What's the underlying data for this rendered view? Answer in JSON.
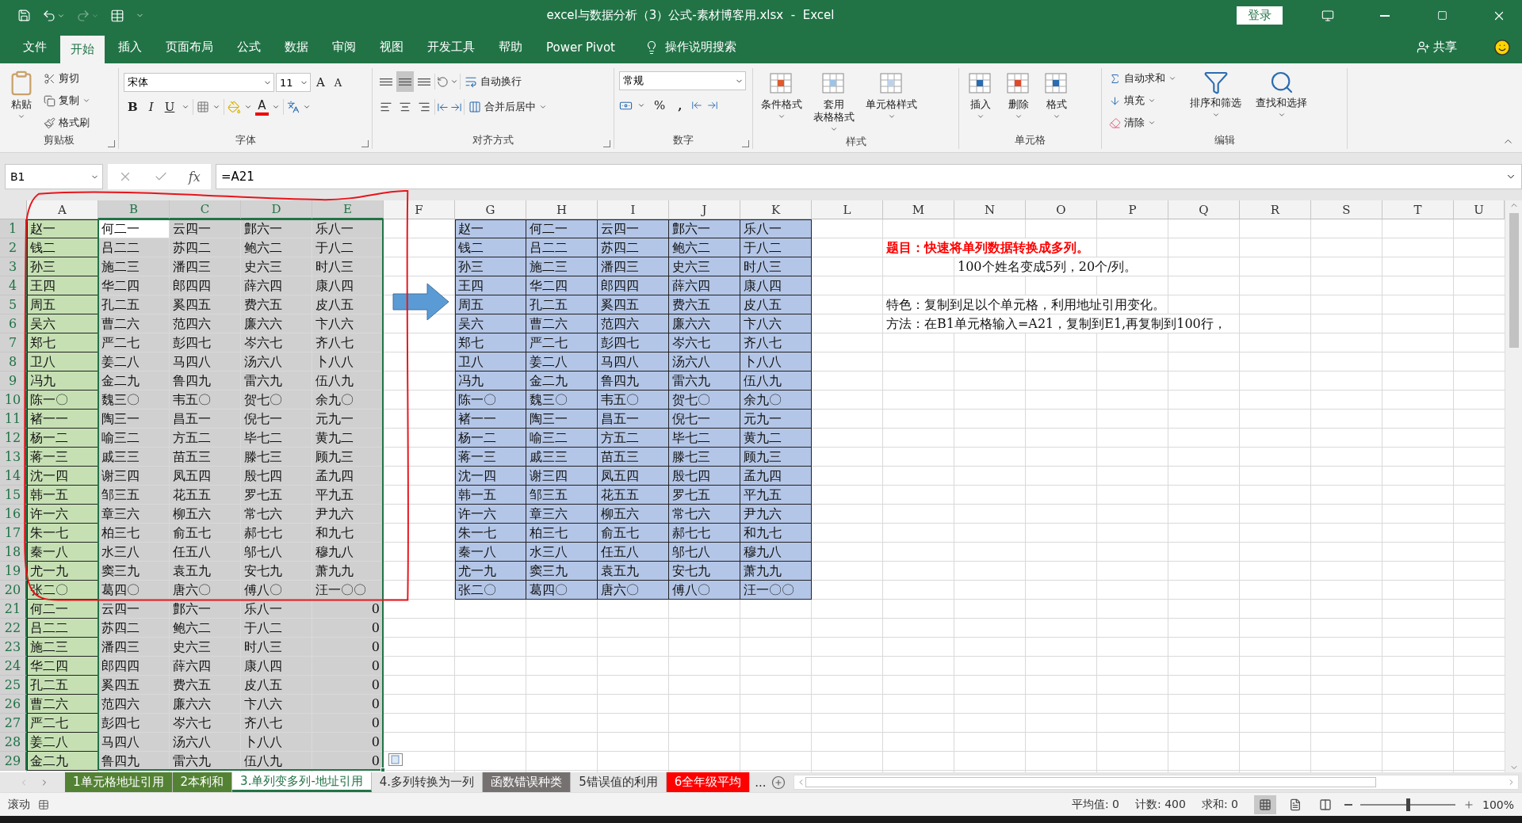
{
  "title_bar": {
    "title": "excel与数据分析（3）公式-素材博客用.xlsx  -  Excel",
    "login": "登录"
  },
  "menu": {
    "tabs": [
      {
        "label": "文件",
        "selected": false
      },
      {
        "label": "开始",
        "selected": true
      },
      {
        "label": "插入",
        "selected": false
      },
      {
        "label": "页面布局",
        "selected": false
      },
      {
        "label": "公式",
        "selected": false
      },
      {
        "label": "数据",
        "selected": false
      },
      {
        "label": "审阅",
        "selected": false
      },
      {
        "label": "视图",
        "selected": false
      },
      {
        "label": "开发工具",
        "selected": false
      },
      {
        "label": "帮助",
        "selected": false
      },
      {
        "label": "Power Pivot",
        "selected": false
      }
    ],
    "tell_me": "操作说明搜索",
    "share": "共享"
  },
  "ribbon": {
    "groups": [
      {
        "kind": "clipboard",
        "title": "剪贴板",
        "launcher": true,
        "paste": "粘贴",
        "items": [
          "剪切",
          "复制",
          "格式刷"
        ]
      },
      {
        "kind": "font",
        "title": "字体",
        "launcher": true,
        "font": "宋体",
        "size": "11",
        "grow": "A",
        "shrink": "A",
        "bold": "B",
        "italic": "I",
        "underline": "U",
        "font_color": "A"
      },
      {
        "kind": "alignment",
        "title": "对齐方式",
        "launcher": true,
        "valign": [
          {
            "selected": false
          },
          {
            "selected": true
          },
          {
            "selected": false
          }
        ],
        "halign": [
          {
            "selected": false
          },
          {
            "selected": false
          },
          {
            "selected": false
          }
        ],
        "wrap": "自动换行",
        "merge": "合并后居中"
      },
      {
        "kind": "number",
        "title": "数字",
        "launcher": true,
        "format": "常规",
        "percent": "%",
        "comma": ","
      },
      {
        "kind": "styles",
        "title": "样式",
        "buttons": [
          [
            "条件格式"
          ],
          [
            "套用",
            "表格格式"
          ],
          [
            "单元格样式"
          ]
        ]
      },
      {
        "kind": "cells",
        "title": "单元格",
        "buttons": [
          [
            "插入"
          ],
          [
            "删除"
          ],
          [
            "格式"
          ]
        ]
      },
      {
        "kind": "editing",
        "title": "编辑",
        "items": [
          "自动求和",
          "填充",
          "清除"
        ],
        "buttons": [
          [
            "排序和筛选"
          ],
          [
            "查找和选择"
          ]
        ]
      }
    ]
  },
  "formula_bar": {
    "name_box": "B1",
    "fx": "fx",
    "formula": "=A21"
  },
  "sheet": {
    "columns": [
      {
        "label": "A",
        "selected": false,
        "color": "#c6e0b4"
      },
      {
        "label": "B",
        "selected": true
      },
      {
        "label": "C",
        "selected": true
      },
      {
        "label": "D",
        "selected": true
      },
      {
        "label": "E",
        "selected": true
      },
      {
        "label": "F",
        "selected": false
      },
      {
        "label": "G",
        "selected": false,
        "color": "#b4c6e7"
      },
      {
        "label": "H",
        "selected": false,
        "color": "#b4c6e7"
      },
      {
        "label": "I",
        "selected": false,
        "color": "#b4c6e7"
      },
      {
        "label": "J",
        "selected": false,
        "color": "#b4c6e7"
      },
      {
        "label": "K",
        "selected": false,
        "color": "#b4c6e7"
      },
      {
        "label": "L",
        "selected": false
      },
      {
        "label": "M",
        "selected": false
      },
      {
        "label": "N",
        "selected": false
      },
      {
        "label": "O",
        "selected": false
      },
      {
        "label": "P",
        "selected": false
      },
      {
        "label": "Q",
        "selected": false
      },
      {
        "label": "R",
        "selected": false
      },
      {
        "label": "S",
        "selected": false
      },
      {
        "label": "T",
        "selected": false
      },
      {
        "label": "U",
        "selected": false
      }
    ],
    "rows": [
      {
        "number": "1",
        "selected": true,
        "cells": {
          "A": "赵一",
          "B": "何二一",
          "C": "云四一",
          "D": "鄷六一",
          "E": "乐八一",
          "G": "赵一",
          "H": "何二一",
          "I": "云四一",
          "J": "鄷六一",
          "K": "乐八一"
        }
      },
      {
        "number": "2",
        "selected": true,
        "cells": {
          "A": "钱二",
          "B": "吕二二",
          "C": "苏四二",
          "D": "鲍六二",
          "E": "于八二",
          "G": "钱二",
          "H": "吕二二",
          "I": "苏四二",
          "J": "鲍六二",
          "K": "于八二",
          "M": {
            "text": "题目：快速将单列数据转换成多列。",
            "kind": "heading"
          }
        }
      },
      {
        "number": "3",
        "selected": true,
        "cells": {
          "A": "孙三",
          "B": "施二三",
          "C": "潘四三",
          "D": "史六三",
          "E": "时八三",
          "G": "孙三",
          "H": "施二三",
          "I": "潘四三",
          "J": "史六三",
          "K": "时八三",
          "N": "100个姓名变成5列，20个/列。"
        }
      },
      {
        "number": "4",
        "selected": true,
        "cells": {
          "A": "王四",
          "B": "华二四",
          "C": "郎四四",
          "D": "薛六四",
          "E": "康八四",
          "G": "王四",
          "H": "华二四",
          "I": "郎四四",
          "J": "薛六四",
          "K": "康八四"
        }
      },
      {
        "number": "5",
        "selected": true,
        "cells": {
          "A": "周五",
          "B": "孔二五",
          "C": "奚四五",
          "D": "费六五",
          "E": "皮八五",
          "G": "周五",
          "H": "孔二五",
          "I": "奚四五",
          "J": "费六五",
          "K": "皮八五",
          "M": "特色：复制到足以个单元格，利用地址引用变化。"
        }
      },
      {
        "number": "6",
        "selected": true,
        "cells": {
          "A": "吴六",
          "B": "曹二六",
          "C": "范四六",
          "D": "廉六六",
          "E": "卞八六",
          "G": "吴六",
          "H": "曹二六",
          "I": "范四六",
          "J": "廉六六",
          "K": "卞八六",
          "M": "方法：在B1单元格输入=A21，复制到E1,再复制到100行，"
        }
      },
      {
        "number": "7",
        "selected": true,
        "cells": {
          "A": "郑七",
          "B": "严二七",
          "C": "彭四七",
          "D": "岑六七",
          "E": "齐八七",
          "G": "郑七",
          "H": "严二七",
          "I": "彭四七",
          "J": "岑六七",
          "K": "齐八七"
        }
      },
      {
        "number": "8",
        "selected": true,
        "cells": {
          "A": "卫八",
          "B": "姜二八",
          "C": "马四八",
          "D": "汤六八",
          "E": "卜八八",
          "G": "卫八",
          "H": "姜二八",
          "I": "马四八",
          "J": "汤六八",
          "K": "卜八八"
        }
      },
      {
        "number": "9",
        "selected": true,
        "cells": {
          "A": "冯九",
          "B": "金二九",
          "C": "鲁四九",
          "D": "雷六九",
          "E": "伍八九",
          "G": "冯九",
          "H": "金二九",
          "I": "鲁四九",
          "J": "雷六九",
          "K": "伍八九"
        }
      },
      {
        "number": "10",
        "selected": true,
        "cells": {
          "A": "陈一〇",
          "B": "魏三〇",
          "C": "韦五〇",
          "D": "贺七〇",
          "E": "余九〇",
          "G": "陈一〇",
          "H": "魏三〇",
          "I": "韦五〇",
          "J": "贺七〇",
          "K": "余九〇"
        }
      },
      {
        "number": "11",
        "selected": true,
        "cells": {
          "A": "褚一一",
          "B": "陶三一",
          "C": "昌五一",
          "D": "倪七一",
          "E": "元九一",
          "G": "褚一一",
          "H": "陶三一",
          "I": "昌五一",
          "J": "倪七一",
          "K": "元九一"
        }
      },
      {
        "number": "12",
        "selected": true,
        "cells": {
          "A": "杨一二",
          "B": "喻三二",
          "C": "方五二",
          "D": "毕七二",
          "E": "黄九二",
          "G": "杨一二",
          "H": "喻三二",
          "I": "方五二",
          "J": "毕七二",
          "K": "黄九二"
        }
      },
      {
        "number": "13",
        "selected": true,
        "cells": {
          "A": "蒋一三",
          "B": "戚三三",
          "C": "苗五三",
          "D": "滕七三",
          "E": "顾九三",
          "G": "蒋一三",
          "H": "戚三三",
          "I": "苗五三",
          "J": "滕七三",
          "K": "顾九三"
        }
      },
      {
        "number": "14",
        "selected": true,
        "cells": {
          "A": "沈一四",
          "B": "谢三四",
          "C": "凤五四",
          "D": "殷七四",
          "E": "孟九四",
          "G": "沈一四",
          "H": "谢三四",
          "I": "凤五四",
          "J": "殷七四",
          "K": "孟九四"
        }
      },
      {
        "number": "15",
        "selected": true,
        "cells": {
          "A": "韩一五",
          "B": "邹三五",
          "C": "花五五",
          "D": "罗七五",
          "E": "平九五",
          "G": "韩一五",
          "H": "邹三五",
          "I": "花五五",
          "J": "罗七五",
          "K": "平九五"
        }
      },
      {
        "number": "16",
        "selected": true,
        "cells": {
          "A": "许一六",
          "B": "章三六",
          "C": "柳五六",
          "D": "常七六",
          "E": "尹九六",
          "G": "许一六",
          "H": "章三六",
          "I": "柳五六",
          "J": "常七六",
          "K": "尹九六"
        }
      },
      {
        "number": "17",
        "selected": true,
        "cells": {
          "A": "朱一七",
          "B": "柏三七",
          "C": "俞五七",
          "D": "郝七七",
          "E": "和九七",
          "G": "朱一七",
          "H": "柏三七",
          "I": "俞五七",
          "J": "郝七七",
          "K": "和九七"
        }
      },
      {
        "number": "18",
        "selected": true,
        "cells": {
          "A": "秦一八",
          "B": "水三八",
          "C": "任五八",
          "D": "邬七八",
          "E": "穆九八",
          "G": "秦一八",
          "H": "水三八",
          "I": "任五八",
          "J": "邬七八",
          "K": "穆九八"
        }
      },
      {
        "number": "19",
        "selected": true,
        "cells": {
          "A": "尤一九",
          "B": "窦三九",
          "C": "袁五九",
          "D": "安七九",
          "E": "萧九九",
          "G": "尤一九",
          "H": "窦三九",
          "I": "袁五九",
          "J": "安七九",
          "K": "萧九九"
        }
      },
      {
        "number": "20",
        "selected": true,
        "cells": {
          "A": "张二〇",
          "B": "葛四〇",
          "C": "唐六〇",
          "D": "傅八〇",
          "E": "汪一〇〇",
          "G": "张二〇",
          "H": "葛四〇",
          "I": "唐六〇",
          "J": "傅八〇",
          "K": "汪一〇〇"
        }
      },
      {
        "number": "21",
        "selected": true,
        "cells": {
          "A": "何二一",
          "B": "云四一",
          "C": "鄷六一",
          "D": "乐八一",
          "E": {
            "text": "0",
            "kind": "number"
          }
        }
      },
      {
        "number": "22",
        "selected": true,
        "cells": {
          "A": "吕二二",
          "B": "苏四二",
          "C": "鲍六二",
          "D": "于八二",
          "E": {
            "text": "0",
            "kind": "number"
          }
        }
      },
      {
        "number": "23",
        "selected": true,
        "cells": {
          "A": "施二三",
          "B": "潘四三",
          "C": "史六三",
          "D": "时八三",
          "E": {
            "text": "0",
            "kind": "number"
          }
        }
      },
      {
        "number": "24",
        "selected": true,
        "cells": {
          "A": "华二四",
          "B": "郎四四",
          "C": "薛六四",
          "D": "康八四",
          "E": {
            "text": "0",
            "kind": "number"
          }
        }
      },
      {
        "number": "25",
        "selected": true,
        "cells": {
          "A": "孔二五",
          "B": "奚四五",
          "C": "费六五",
          "D": "皮八五",
          "E": {
            "text": "0",
            "kind": "number"
          }
        }
      },
      {
        "number": "26",
        "selected": true,
        "cells": {
          "A": "曹二六",
          "B": "范四六",
          "C": "廉六六",
          "D": "卞八六",
          "E": {
            "text": "0",
            "kind": "number"
          }
        }
      },
      {
        "number": "27",
        "selected": true,
        "cells": {
          "A": "严二七",
          "B": "彭四七",
          "C": "岑六七",
          "D": "齐八七",
          "E": {
            "text": "0",
            "kind": "number"
          }
        }
      },
      {
        "number": "28",
        "selected": true,
        "cells": {
          "A": "姜二八",
          "B": "马四八",
          "C": "汤六八",
          "D": "卜八八",
          "E": {
            "text": "0",
            "kind": "number"
          }
        }
      },
      {
        "number": "29",
        "selected": true,
        "cells": {
          "A": "金二九",
          "B": "鲁四九",
          "C": "雷六九",
          "D": "伍八九",
          "E": {
            "text": "0",
            "kind": "number"
          }
        }
      }
    ]
  },
  "sheet_tabs": {
    "tabs": [
      {
        "label": "1单元格地址引用",
        "selected": false,
        "color": "#548235"
      },
      {
        "label": "2本利和",
        "selected": false,
        "color": "#548235"
      },
      {
        "label": "3.单列变多列-地址引用",
        "selected": true
      },
      {
        "label": "4.多列转换为一列",
        "selected": false
      },
      {
        "label": "函数错误种类",
        "selected": false,
        "color": "#767171"
      },
      {
        "label": "5错误值的利用",
        "selected": false
      },
      {
        "label": "6全年级平均",
        "selected": false,
        "color": "#ff0000"
      }
    ],
    "more": "..."
  },
  "status_bar": {
    "mode": "滚动",
    "stats": [
      "平均值: 0",
      "计数: 400",
      "求和: 0"
    ],
    "views": [
      {
        "selected": true
      },
      {
        "selected": false
      },
      {
        "selected": false
      }
    ],
    "zoom": {
      "level": 0.5,
      "label": "100%"
    }
  }
}
